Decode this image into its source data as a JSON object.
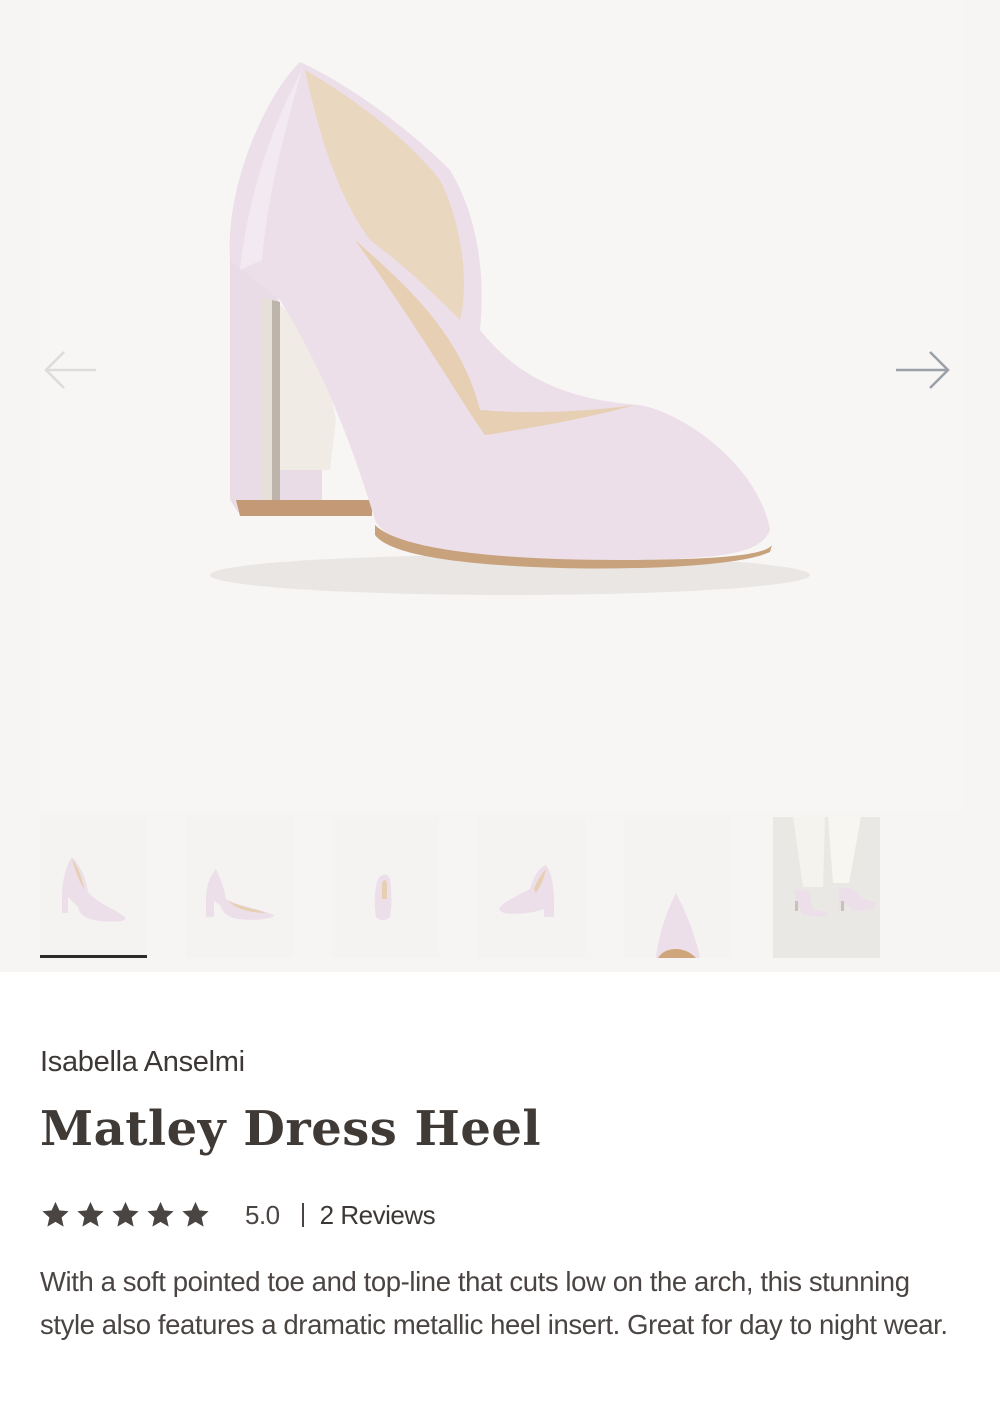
{
  "product": {
    "brand": "Isabella Anselmi",
    "name": "Matley Dress Heel",
    "rating": {
      "stars": 5,
      "max_stars": 5,
      "value": "5.0",
      "separator": "|",
      "reviews_label": "2 Reviews"
    },
    "description": "With a soft pointed toe and top-line that cuts low on the arch, this stunning style also features a dramatic metallic heel insert. Great for day to night wear."
  },
  "gallery": {
    "prev_icon": "arrow-left-icon",
    "next_icon": "arrow-right-icon",
    "selected_index": 0,
    "thumbnail_count": 6
  },
  "colors": {
    "shoe": "#ecdfe9",
    "lining": "#e7d2b8",
    "heel_insert": "#efeae3",
    "text": "#403a36",
    "active_underline": "#2b2b2b",
    "gallery_bg": "#f7f5f4"
  }
}
